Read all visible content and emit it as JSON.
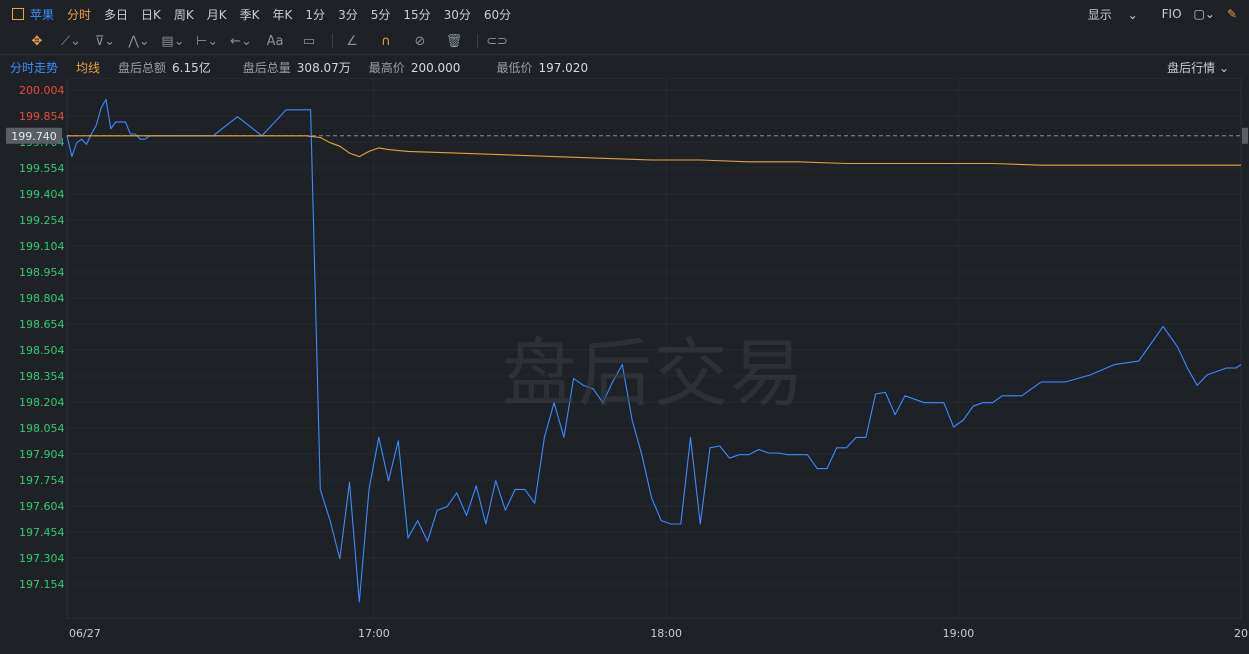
{
  "toolbar": {
    "symbol": "苹果",
    "tabs": [
      "分时",
      "多日",
      "日K",
      "周K",
      "月K",
      "季K",
      "年K",
      "1分",
      "3分",
      "5分",
      "15分",
      "30分",
      "60分"
    ],
    "active_tab": "分时",
    "display_label": "显示",
    "fio_label": "FIO"
  },
  "draw_tools": [
    "move-tool-icon",
    "line-tool-icon",
    "channel-tool-icon",
    "polyline-tool-icon",
    "fib-tool-icon",
    "measure-tool-icon",
    "arrow-tool-icon",
    "text-tool-icon",
    "note-tool-icon",
    "ruler-tool-icon",
    "magnet-icon",
    "hide-icon",
    "trash-icon",
    "link-icon"
  ],
  "text_tool_label": "Aa",
  "info": {
    "tab_label": "分时走势",
    "avg_label": "均线",
    "amount_label": "盘后总额",
    "amount_value": "6.15亿",
    "volume_label": "盘后总量",
    "volume_value": "308.07万",
    "high_label": "最高价",
    "high_value": "200.000",
    "low_label": "最低价",
    "low_value": "197.020",
    "dropdown_label": "盘后行情"
  },
  "watermark": "盘后交易",
  "colors": {
    "price_line": "#3d8bfd",
    "avg_line": "#e6a23c",
    "up": "#e74c3c",
    "down": "#2ecc71",
    "ref_line": "#8a8f96"
  },
  "chart_data": {
    "type": "line",
    "title": "",
    "xlabel": "",
    "ylabel": "",
    "ylim": [
      197.004,
      200.004
    ],
    "x_ticks": [
      "06/27",
      "17:00",
      "18:00",
      "19:00",
      "20"
    ],
    "x_tick_minutes": [
      0,
      63,
      123,
      183,
      241
    ],
    "y_ticks": [
      "200.004",
      "199.854",
      "199.704",
      "199.554",
      "199.404",
      "199.254",
      "199.104",
      "198.954",
      "198.804",
      "198.654",
      "198.504",
      "198.354",
      "198.204",
      "198.054",
      "197.904",
      "197.754",
      "197.604",
      "197.454",
      "197.304",
      "197.154"
    ],
    "reference_price": 199.74,
    "reference_label": "199.740",
    "grid": true,
    "x_minutes_max": 241,
    "series": [
      {
        "name": "分时走势",
        "x": [
          0,
          1,
          2,
          3,
          4,
          5,
          6,
          7,
          8,
          9,
          10,
          11,
          12,
          13,
          14,
          15,
          16,
          17,
          18,
          20,
          25,
          30,
          35,
          40,
          45,
          50,
          52,
          54,
          56,
          58,
          60,
          62,
          64,
          66,
          68,
          70,
          72,
          74,
          76,
          78,
          80,
          82,
          84,
          86,
          88,
          90,
          92,
          94,
          96,
          98,
          100,
          102,
          104,
          106,
          108,
          110,
          112,
          114,
          116,
          118,
          120,
          122,
          124,
          126,
          128,
          130,
          132,
          134,
          136,
          138,
          140,
          142,
          144,
          146,
          148,
          150,
          152,
          154,
          156,
          158,
          160,
          162,
          164,
          166,
          168,
          170,
          172,
          174,
          176,
          178,
          180,
          182,
          184,
          186,
          188,
          190,
          192,
          194,
          196,
          198,
          200,
          205,
          210,
          215,
          220,
          225,
          228,
          230,
          232,
          234,
          236,
          238,
          240,
          241
        ],
        "y": [
          199.74,
          199.62,
          199.7,
          199.72,
          199.69,
          199.75,
          199.8,
          199.9,
          199.95,
          199.78,
          199.82,
          199.82,
          199.82,
          199.75,
          199.75,
          199.72,
          199.72,
          199.74,
          199.74,
          199.74,
          199.74,
          199.74,
          199.85,
          199.74,
          199.89,
          199.89,
          197.7,
          197.52,
          197.3,
          197.74,
          197.05,
          197.7,
          198.0,
          197.75,
          197.98,
          197.42,
          197.52,
          197.4,
          197.58,
          197.6,
          197.68,
          197.55,
          197.72,
          197.5,
          197.75,
          197.58,
          197.7,
          197.7,
          197.62,
          198.0,
          198.2,
          198.0,
          198.34,
          198.3,
          198.28,
          198.2,
          198.32,
          198.42,
          198.1,
          197.9,
          197.65,
          197.52,
          197.5,
          197.5,
          198.0,
          197.5,
          197.94,
          197.95,
          197.88,
          197.9,
          197.9,
          197.93,
          197.91,
          197.91,
          197.9,
          197.9,
          197.9,
          197.82,
          197.82,
          197.94,
          197.94,
          198.0,
          198.0,
          198.25,
          198.26,
          198.13,
          198.24,
          198.22,
          198.2,
          198.2,
          198.2,
          198.06,
          198.1,
          198.18,
          198.2,
          198.2,
          198.24,
          198.24,
          198.24,
          198.28,
          198.32,
          198.32,
          198.36,
          198.42,
          198.44,
          198.64,
          198.52,
          198.4,
          198.3,
          198.36,
          198.38,
          198.4,
          198.4,
          198.42
        ]
      },
      {
        "name": "均线",
        "x": [
          0,
          10,
          20,
          30,
          40,
          49,
          52,
          54,
          56,
          58,
          60,
          62,
          64,
          66,
          70,
          80,
          90,
          100,
          110,
          120,
          130,
          140,
          150,
          160,
          170,
          180,
          190,
          200,
          210,
          220,
          230,
          241
        ],
        "y": [
          199.74,
          199.74,
          199.74,
          199.74,
          199.74,
          199.74,
          199.73,
          199.7,
          199.68,
          199.64,
          199.62,
          199.65,
          199.67,
          199.66,
          199.65,
          199.64,
          199.63,
          199.62,
          199.61,
          199.6,
          199.6,
          199.59,
          199.59,
          199.58,
          199.58,
          199.58,
          199.58,
          199.57,
          199.57,
          199.57,
          199.57,
          199.57
        ]
      }
    ]
  }
}
